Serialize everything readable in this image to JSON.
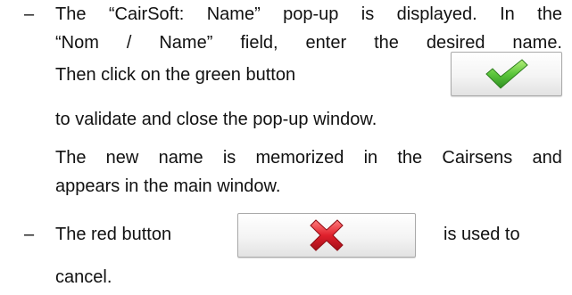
{
  "bullet_marker": "–",
  "item1": {
    "line1": [
      "The",
      "“CairSoft:",
      "Name”",
      "pop-up",
      "is",
      "displayed.",
      "In",
      "the"
    ],
    "line2": [
      "“Nom",
      "/",
      "Name”",
      "field,",
      "enter",
      "the",
      "desired",
      "name."
    ],
    "line3": "Then click on the green button",
    "line4": "to validate and close the pop-up window.",
    "line5": [
      "The",
      "new",
      "name",
      "is",
      "memorized",
      "in",
      "the",
      "Cairsens",
      "and"
    ],
    "line6": "appears in the main window.",
    "validate_icon": "green-checkmark-icon"
  },
  "item2": {
    "text_before": "The red button",
    "text_after": "is used to",
    "line2": "cancel.",
    "cancel_icon": "red-cross-icon"
  },
  "colors": {
    "check_green": "#5cc63c",
    "cross_red": "#e0202c"
  }
}
